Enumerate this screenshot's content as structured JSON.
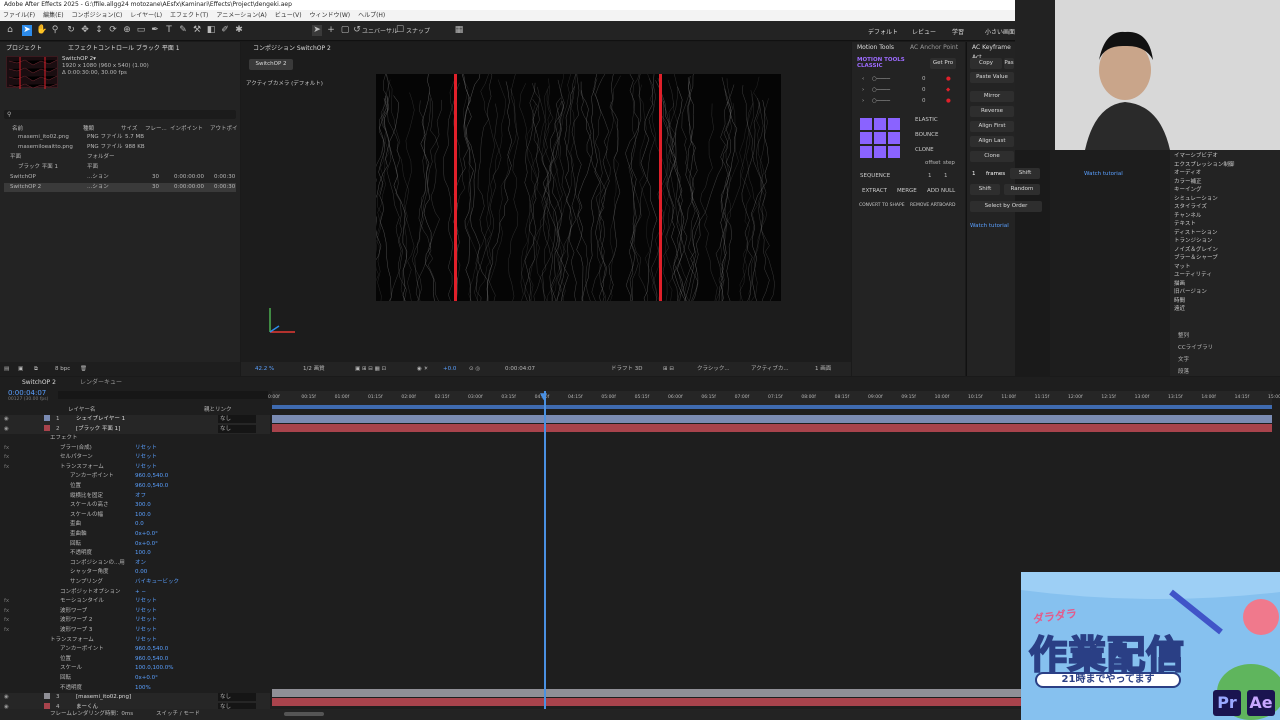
{
  "title": "Adobe After Effects 2025 - G:\\ffile.allgg24 motozane\\AEsfx\\Kaminari\\Effects\\Project\\dengeki.aep",
  "menu": [
    "ファイル(F)",
    "編集(E)",
    "コンポジション(C)",
    "レイヤー(L)",
    "エフェクト(T)",
    "アニメーション(A)",
    "ビュー(V)",
    "ウィンドウ(W)",
    "ヘルプ(H)"
  ],
  "toolbar": {
    "snap_label": "スナップ",
    "universal_label": "ユニバーサル",
    "workspaces": [
      "デフォルト",
      "レビュー",
      "学習",
      "小さい画面"
    ]
  },
  "project": {
    "tab_project": "プロジェクト",
    "tab_effects": "エフェクトコントロール ブラック 平面 1",
    "item_name": "SwitchOP 2▾",
    "item_info1": "1920 x 1080 (960 x 540) (1.00)",
    "item_info2": "Δ 0:00:30:00, 30.00 fps",
    "cols": [
      "名前",
      "種類",
      "サイズ",
      "フレー...",
      "インポイント",
      "アウトポイ"
    ],
    "rows": [
      {
        "name": "masemi_ito02.png",
        "type": "PNG ファイル",
        "size": "5.7 MB",
        "fr": "",
        "in": "",
        "out": ""
      },
      {
        "name": "masemiloeaitto.png",
        "type": "PNG ファイル",
        "size": "988 KB",
        "fr": "",
        "in": "",
        "out": ""
      },
      {
        "name": "平面",
        "type": "フォルダー",
        "size": "",
        "fr": "",
        "in": "",
        "out": ""
      },
      {
        "name": "ブラック 平面 1",
        "type": "平面",
        "size": "",
        "fr": "",
        "in": "",
        "out": ""
      },
      {
        "name": "SwitchOP",
        "type": "...ション",
        "size": "",
        "fr": "30",
        "in": "0:00:00:00",
        "out": "0:00:30"
      },
      {
        "name": "SwitchOP 2",
        "type": "...ション",
        "size": "",
        "fr": "30",
        "in": "0:00:00:00",
        "out": "0:00:30"
      }
    ],
    "bpc": "8 bpc"
  },
  "comp": {
    "tab": "コンポジション SwitchOP 2",
    "subtab": "SwitchOP 2",
    "camera": "アクティブカメラ (デフォルト)",
    "zoom": "42.2 %",
    "resolution": "1/2 画質",
    "timecode": "0:00:04:07",
    "draft": "ドラフト 3D",
    "renderer": "クラシック...",
    "camera_sel": "アクティブカ...",
    "views": "1 画面",
    "exposure": "+0.0"
  },
  "motion_tools": {
    "tab1": "Motion Tools",
    "tab2": "AC Anchor Point",
    "brand1": "MOTION TOOLS",
    "brand2": "CLASSIC",
    "get_pro": "Get Pro",
    "vals": [
      "0",
      "0",
      "0"
    ],
    "elastic": "ELASTIC",
    "bounce": "BOUNCE",
    "clone": "CLONE",
    "offset": "offset",
    "step": "step",
    "off_val": "1",
    "step_val": "1",
    "sequence": "SEQUENCE",
    "extract": "EXTRACT",
    "merge": "MERGE",
    "add_null": "ADD NULL",
    "convert": "CONVERT TO SHAPE",
    "remove": "REMOVE ARTBOARD"
  },
  "keyframe": {
    "tab": "AC Keyframe Act",
    "copy": "Copy",
    "paste": "Pas",
    "paste_value": "Paste Value",
    "mirror": "Mirror",
    "reverse": "Reverse",
    "align_first": "Align First",
    "align_last": "Align Last",
    "clone": "Clone",
    "frames_val": "1",
    "frames": "frames",
    "shift": "Shift",
    "shift2": "Shift",
    "random": "Random",
    "select_order": "Select by Order",
    "watch1": "Watch tutorial",
    "watch2": "Watch tutorial"
  },
  "fx_categories": [
    "イマーシブビデオ",
    "エクスプレッション制御",
    "オーディオ",
    "カラー補正",
    "キーイング",
    "シミュレーション",
    "スタイライズ",
    "チャンネル",
    "テキスト",
    "ディストーション",
    "トランジション",
    "ノイズ＆グレイン",
    "ブラー＆シャープ",
    "マット",
    "ユーティリティ",
    "描画",
    "旧バージョン",
    "時間",
    "遠近"
  ],
  "side_panels": [
    "整列",
    "CCライブラリ",
    "文字",
    "段落"
  ],
  "timeline": {
    "tab": "SwitchOP 2",
    "render_tab": "レンダーキュー",
    "timecode": "0:00:04:07",
    "sub_tc": "00127 (30.00 fps)",
    "col_layer": "レイヤー名",
    "col_parent": "親とリンク",
    "ticks": [
      "0:00f",
      "00:15f",
      "01:00f",
      "01:15f",
      "02:00f",
      "02:15f",
      "03:00f",
      "03:15f",
      "04:00f",
      "04:15f",
      "05:00f",
      "05:15f",
      "06:00f",
      "06:15f",
      "07:00f",
      "07:15f",
      "08:00f",
      "08:15f",
      "09:00f",
      "09:15f",
      "10:00f",
      "10:15f",
      "11:00f",
      "11:15f",
      "12:00f",
      "12:15f",
      "13:00f",
      "13:15f",
      "14:00f",
      "14:15f",
      "15:00f"
    ],
    "layers": [
      {
        "num": "1",
        "name": "シェイプレイヤー 1",
        "parent": "なし"
      },
      {
        "num": "2",
        "name": "[ブラック 平面 1]",
        "parent": "なし"
      }
    ],
    "props": [
      {
        "ind": 1,
        "label": "エフェクト",
        "val": ""
      },
      {
        "ind": 2,
        "label": "ブラー(合成)",
        "val": "リセット"
      },
      {
        "ind": 2,
        "label": "セルパターン",
        "val": "リセット"
      },
      {
        "ind": 2,
        "label": "トランスフォーム",
        "val": "リセット"
      },
      {
        "ind": 3,
        "label": "アンカーポイント",
        "val": "960.0,540.0"
      },
      {
        "ind": 3,
        "label": "位置",
        "val": "960.0,540.0"
      },
      {
        "ind": 3,
        "label": "縦横比を固定",
        "val": "オフ"
      },
      {
        "ind": 3,
        "label": "スケールの高さ",
        "val": "300.0"
      },
      {
        "ind": 3,
        "label": "スケールの幅",
        "val": "100.0"
      },
      {
        "ind": 3,
        "label": "歪曲",
        "val": "0.0"
      },
      {
        "ind": 3,
        "label": "歪曲軸",
        "val": "0x+0.0°"
      },
      {
        "ind": 3,
        "label": "回転",
        "val": "0x+0.0°"
      },
      {
        "ind": 3,
        "label": "不透明度",
        "val": "100.0"
      },
      {
        "ind": 3,
        "label": "コンポジションの...用",
        "val": "オン"
      },
      {
        "ind": 3,
        "label": "シャッター角度",
        "val": "0.00"
      },
      {
        "ind": 3,
        "label": "サンプリング",
        "val": "バイキュービック"
      },
      {
        "ind": 2,
        "label": "コンポジットオプション",
        "val": "+ −"
      },
      {
        "ind": 2,
        "label": "モーションタイル",
        "val": "リセット"
      },
      {
        "ind": 2,
        "label": "波形ワープ",
        "val": "リセット"
      },
      {
        "ind": 2,
        "label": "波形ワープ 2",
        "val": "リセット"
      },
      {
        "ind": 2,
        "label": "波形ワープ 3",
        "val": "リセット"
      },
      {
        "ind": 1,
        "label": "トランスフォーム",
        "val": "リセット"
      },
      {
        "ind": 2,
        "label": "アンカーポイント",
        "val": "960.0,540.0"
      },
      {
        "ind": 2,
        "label": "位置",
        "val": "960.0,540.0"
      },
      {
        "ind": 2,
        "label": "スケール",
        "val": "100.0,100.0%"
      },
      {
        "ind": 2,
        "label": "回転",
        "val": "0x+0.0°"
      },
      {
        "ind": 2,
        "label": "不透明度",
        "val": "100%"
      }
    ],
    "bottom_layers": [
      {
        "num": "3",
        "name": "[masemi_ito02.png]",
        "parent": "なし"
      },
      {
        "num": "4",
        "name": "まーくん",
        "parent": "なし"
      }
    ],
    "footer_left": "フレームレンダリング時間：0ms",
    "footer_mid": "スイッチ / モード"
  },
  "overlay": {
    "top_text": "ダラダラ",
    "title": "作業配信",
    "subtitle": "21時までやってます",
    "app1": "Pr",
    "app2": "Ae"
  },
  "colors": {
    "accent": "#2d8ceb",
    "red": "#e0202a",
    "playhead": "#4a90e2"
  }
}
